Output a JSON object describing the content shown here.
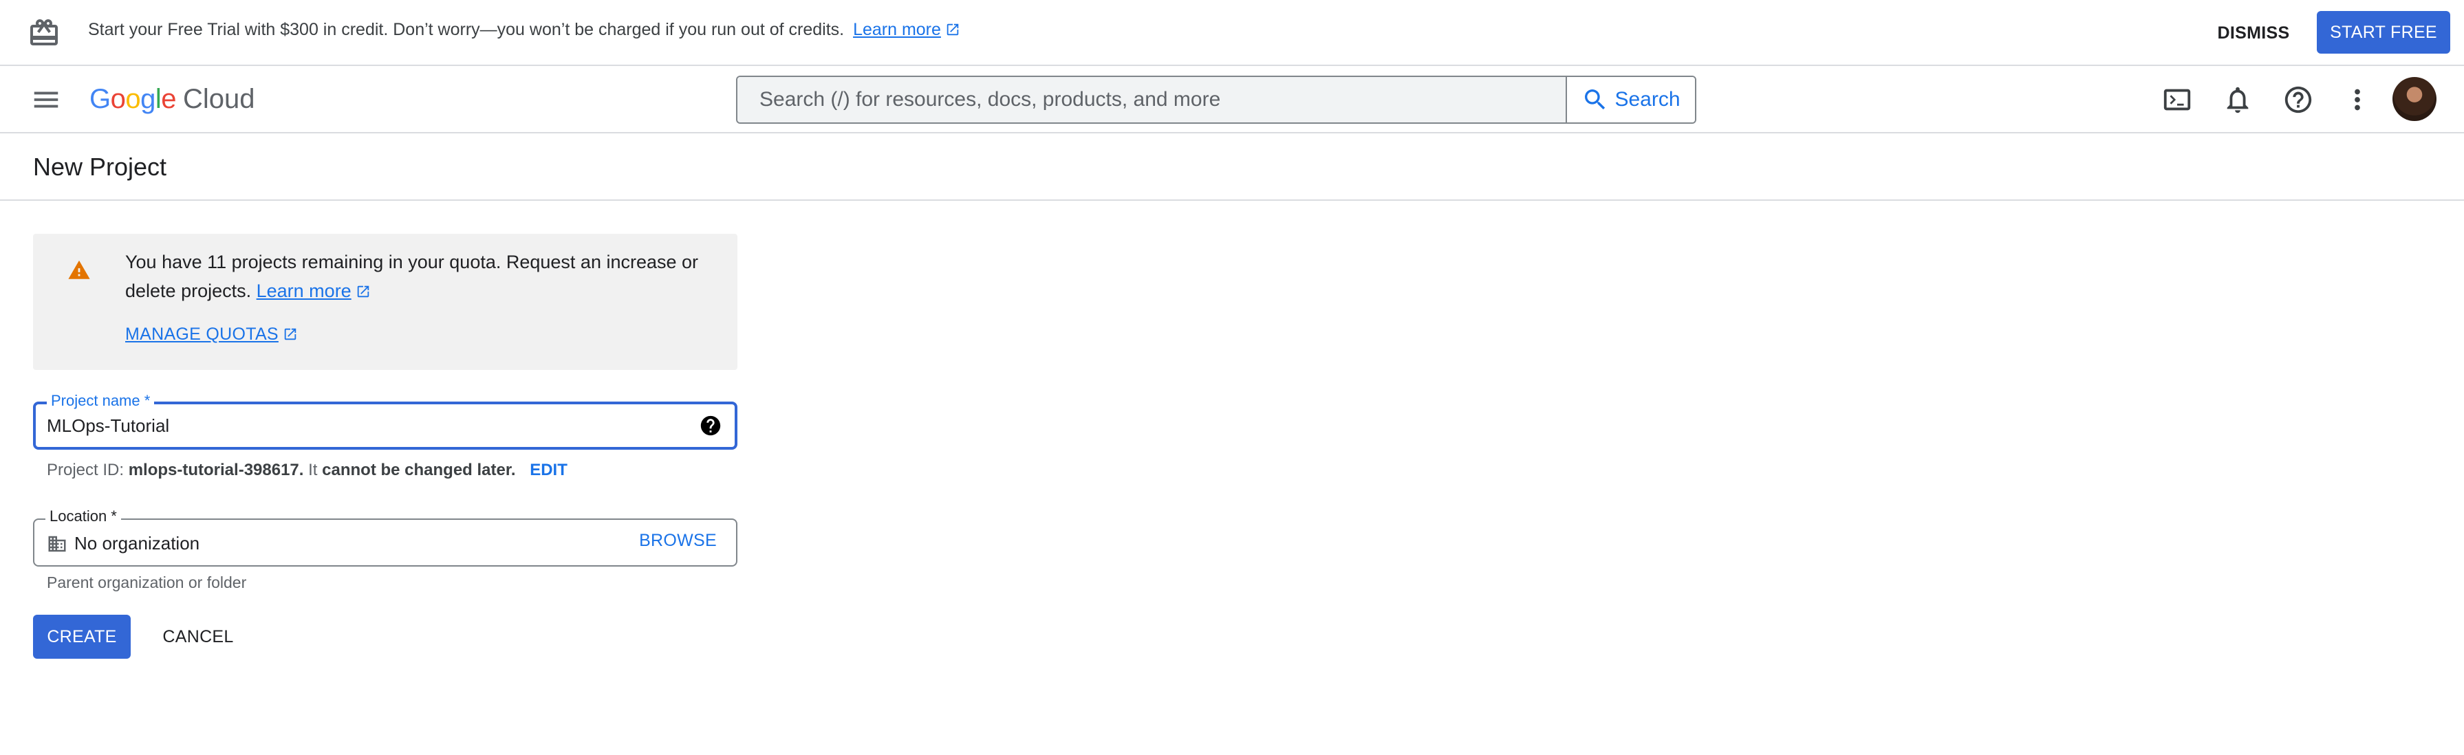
{
  "banner": {
    "message": "Start your Free Trial with $300 in credit. Don’t worry—you won’t be charged if you run out of credits.",
    "learn_more": "Learn more",
    "dismiss_label": "DISMISS",
    "start_free_label": "START FREE",
    "icon": "gift-icon"
  },
  "header": {
    "logo_google": "Google",
    "logo_cloud": "Cloud",
    "search_placeholder": "Search (/) for resources, docs, products, and more",
    "search_button": "Search",
    "icons": [
      "menu-icon",
      "cloud-shell-icon",
      "notifications-icon",
      "help-icon",
      "more-vert-icon",
      "avatar"
    ]
  },
  "page": {
    "title": "New Project"
  },
  "quota_notice": {
    "text": "You have 11 projects remaining in your quota. Request an increase or delete projects.",
    "learn_more": "Learn more",
    "manage_quotas": "MANAGE QUOTAS"
  },
  "form": {
    "project_name_label": "Project name *",
    "project_name_value": "MLOps-Tutorial",
    "project_id_prefix": "Project ID:",
    "project_id": "mlops-tutorial-398617.",
    "project_id_suffix_1": "It",
    "project_id_suffix_2": "cannot be changed later.",
    "edit_label": "EDIT",
    "location_label": "Location *",
    "location_value": "No organization",
    "browse_label": "BROWSE",
    "location_hint": "Parent organization or folder",
    "create_label": "CREATE",
    "cancel_label": "CANCEL"
  },
  "colors": {
    "primary": "#3367d6",
    "link": "#1a73e8",
    "warning": "#e37400",
    "divider": "#dadce0"
  }
}
